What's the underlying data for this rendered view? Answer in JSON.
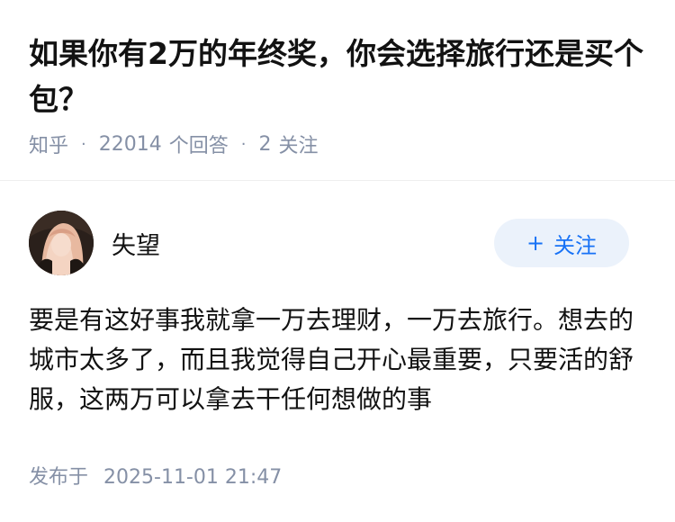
{
  "question": {
    "title": "如果你有2万的年终奖，你会选择旅行还是买个包？",
    "source": "知乎",
    "answer_count": "22014",
    "answer_count_label": "个回答",
    "follower_count": "2",
    "follower_label": "关注"
  },
  "answer": {
    "author_name": "失望",
    "follow_button_plus": "+",
    "follow_button_label": "关注",
    "content": "要是有这好事我就拿一万去理财，一万去旅行。想去的城市太多了，而且我觉得自己开心最重要，只要活的舒服，这两万可以拿去干任何想做的事",
    "published_label": "发布于",
    "published_time": "2025-11-01 21:47"
  },
  "colors": {
    "accent": "#1772f6",
    "follow_button_bg": "#ebf2fb",
    "meta_text": "#8590a6",
    "primary_text": "#121212"
  }
}
